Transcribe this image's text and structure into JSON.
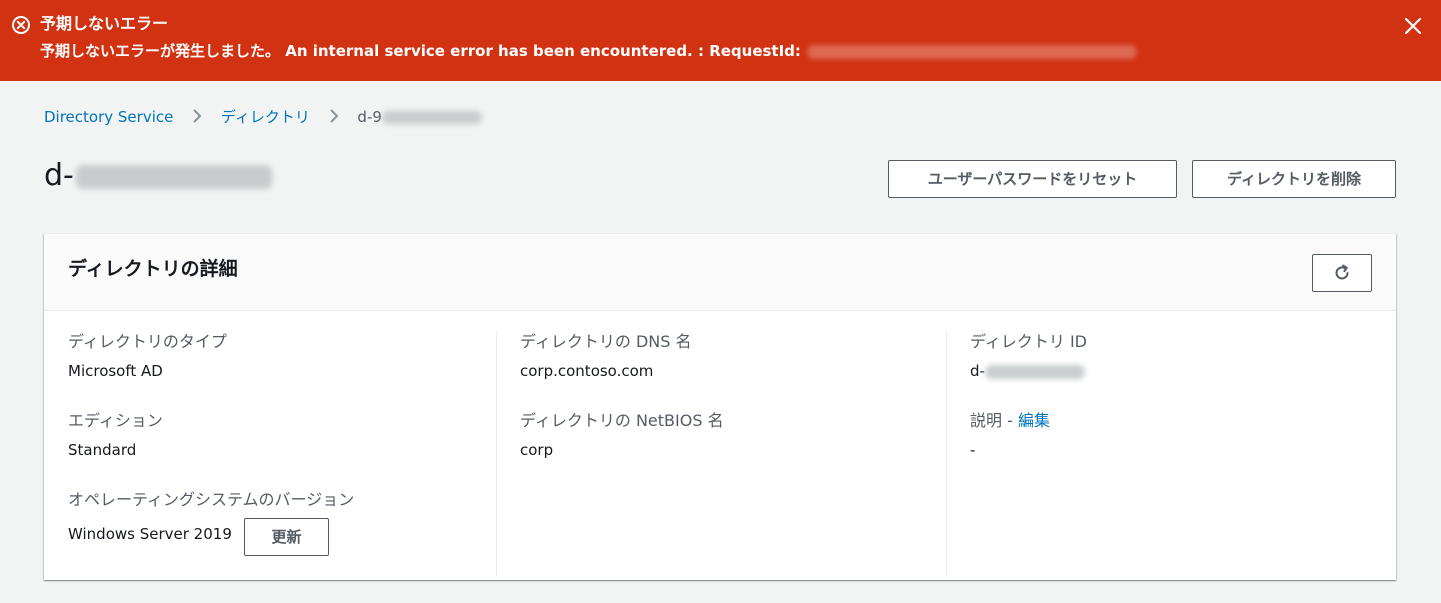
{
  "flash": {
    "title": "予期しないエラー",
    "message": "予期しないエラーが発生しました。 An internal service error has been encountered. : RequestId:",
    "colors": {
      "background": "#d13212",
      "text": "#ffffff"
    },
    "icons": {
      "status": "error-circle-icon",
      "close": "close-icon"
    }
  },
  "breadcrumb": {
    "items": [
      "Directory Service",
      "ディレクトリ"
    ],
    "current": "d-9"
  },
  "page": {
    "title": "d-",
    "buttons": {
      "reset_password": "ユーザーパスワードをリセット",
      "delete_directory": "ディレクトリを削除"
    }
  },
  "panel": {
    "title": "ディレクトリの詳細",
    "refresh_icon": "refresh-icon",
    "fields": {
      "type": {
        "label": "ディレクトリのタイプ",
        "value": "Microsoft AD"
      },
      "edition": {
        "label": "エディション",
        "value": "Standard"
      },
      "os_version": {
        "label": "オペレーティングシステムのバージョン",
        "value": "Windows Server 2019",
        "button": "更新"
      },
      "dns_name": {
        "label": "ディレクトリの DNS 名",
        "value": "corp.contoso.com"
      },
      "netbios_name": {
        "label": "ディレクトリの NetBIOS 名",
        "value": "corp"
      },
      "directory_id": {
        "label": "ディレクトリ ID",
        "value": "d-"
      },
      "description": {
        "label": "説明",
        "separator": " - ",
        "edit_link": "編集",
        "value": "-"
      }
    }
  },
  "colors": {
    "link": "#0073bb",
    "page_bg": "#f2f3f3",
    "label": "#545b64"
  }
}
